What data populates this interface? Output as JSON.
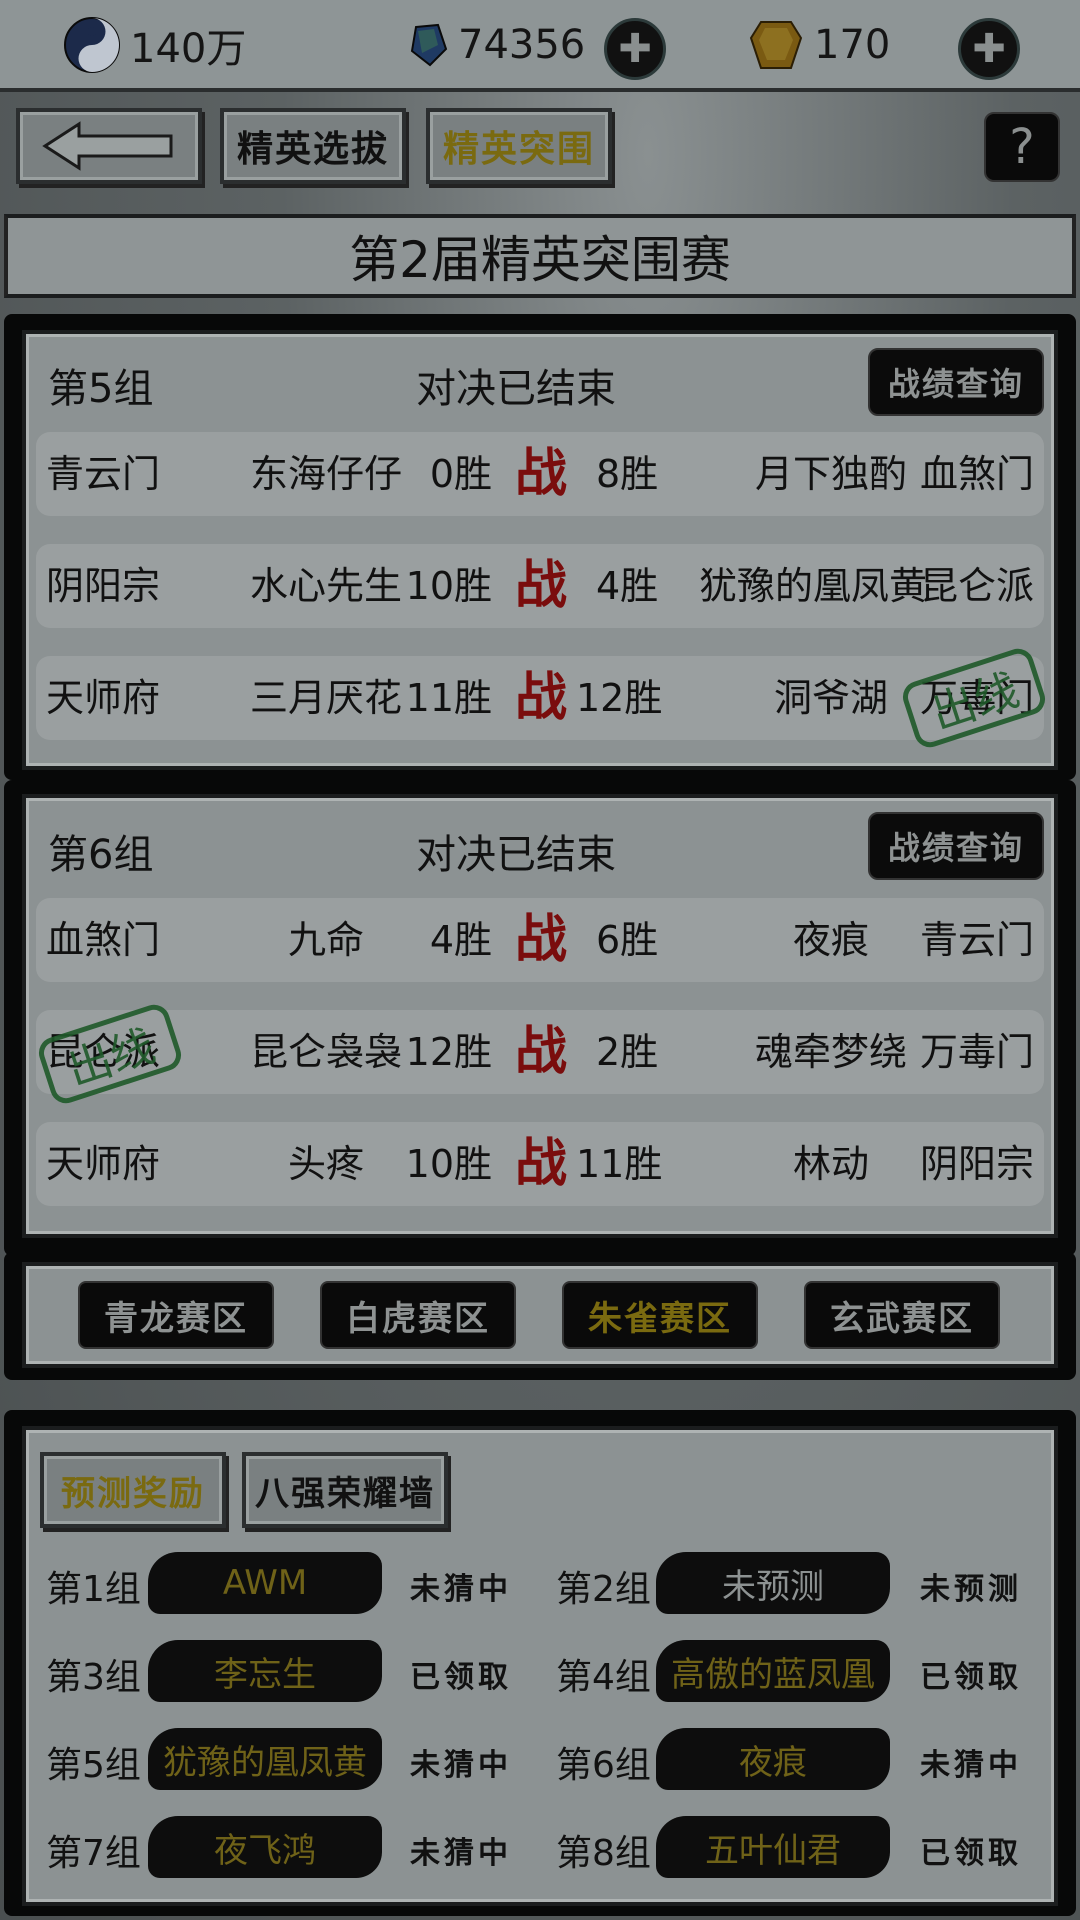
{
  "top_bar": {
    "resources": [
      {
        "icon": "taiji-icon",
        "value": "140万"
      },
      {
        "icon": "gem-icon",
        "value": "74356"
      },
      {
        "icon": "gold-ingot-icon",
        "value": "170"
      }
    ]
  },
  "nav": {
    "back_label": "←",
    "tabs": [
      {
        "label": "精英选拔",
        "active": false
      },
      {
        "label": "精英突围",
        "active": true
      }
    ],
    "help_label": "?"
  },
  "banner_title": "第2届精英突围赛",
  "groups": [
    {
      "name": "第5组",
      "status": "对决已结束",
      "record_label": "战绩查询",
      "matches": [
        {
          "sect_a": "青云门",
          "player_a": "东海仔仔",
          "wins_a": "0胜",
          "vs": "战",
          "wins_b": "8胜",
          "player_b": "月下独酌",
          "sect_b": "血煞门"
        },
        {
          "sect_a": "阴阳宗",
          "player_a": "水心先生",
          "wins_a": "10胜",
          "vs": "战",
          "wins_b": "4胜",
          "player_b": "犹豫的凰凤黄",
          "sect_b": "昆仑派"
        },
        {
          "sect_a": "天师府",
          "player_a": "三月厌花",
          "wins_a": "11胜",
          "vs": "战",
          "wins_b": "12胜",
          "player_b": "洞爷湖",
          "sect_b": "万毒门",
          "stamp_b": "出线"
        }
      ]
    },
    {
      "name": "第6组",
      "status": "对决已结束",
      "record_label": "战绩查询",
      "matches": [
        {
          "sect_a": "血煞门",
          "player_a": "九命",
          "wins_a": "4胜",
          "vs": "战",
          "wins_b": "6胜",
          "player_b": "夜痕",
          "sect_b": "青云门"
        },
        {
          "sect_a": "昆仑派",
          "player_a": "昆仑袅袅",
          "wins_a": "12胜",
          "vs": "战",
          "wins_b": "2胜",
          "player_b": "魂牵梦绕",
          "sect_b": "万毒门",
          "stamp_a": "出线"
        },
        {
          "sect_a": "天师府",
          "player_a": "头疼",
          "wins_a": "10胜",
          "vs": "战",
          "wins_b": "11胜",
          "player_b": "林动",
          "sect_b": "阴阳宗"
        }
      ]
    }
  ],
  "zones": [
    {
      "label": "青龙赛区",
      "active": false
    },
    {
      "label": "白虎赛区",
      "active": false
    },
    {
      "label": "朱雀赛区",
      "active": true
    },
    {
      "label": "玄武赛区",
      "active": false
    }
  ],
  "prediction": {
    "tabs": [
      {
        "label": "预测奖励",
        "active": true
      },
      {
        "label": "八强荣耀墙",
        "active": false
      }
    ],
    "entries": [
      {
        "group": "第1组",
        "pick": "AWM",
        "status": "未猜中",
        "pick_color": "gold"
      },
      {
        "group": "第2组",
        "pick": "未预测",
        "status": "未预测",
        "pick_color": "white"
      },
      {
        "group": "第3组",
        "pick": "李忘生",
        "status": "已领取",
        "pick_color": "gold"
      },
      {
        "group": "第4组",
        "pick": "高傲的蓝凤凰",
        "status": "已领取",
        "pick_color": "gold"
      },
      {
        "group": "第5组",
        "pick": "犹豫的凰凤黄",
        "status": "未猜中",
        "pick_color": "gold"
      },
      {
        "group": "第6组",
        "pick": "夜痕",
        "status": "未猜中",
        "pick_color": "gold"
      },
      {
        "group": "第7组",
        "pick": "夜飞鸿",
        "status": "未猜中",
        "pick_color": "gold"
      },
      {
        "group": "第8组",
        "pick": "五叶仙君",
        "status": "已领取",
        "pick_color": "gold"
      }
    ]
  }
}
